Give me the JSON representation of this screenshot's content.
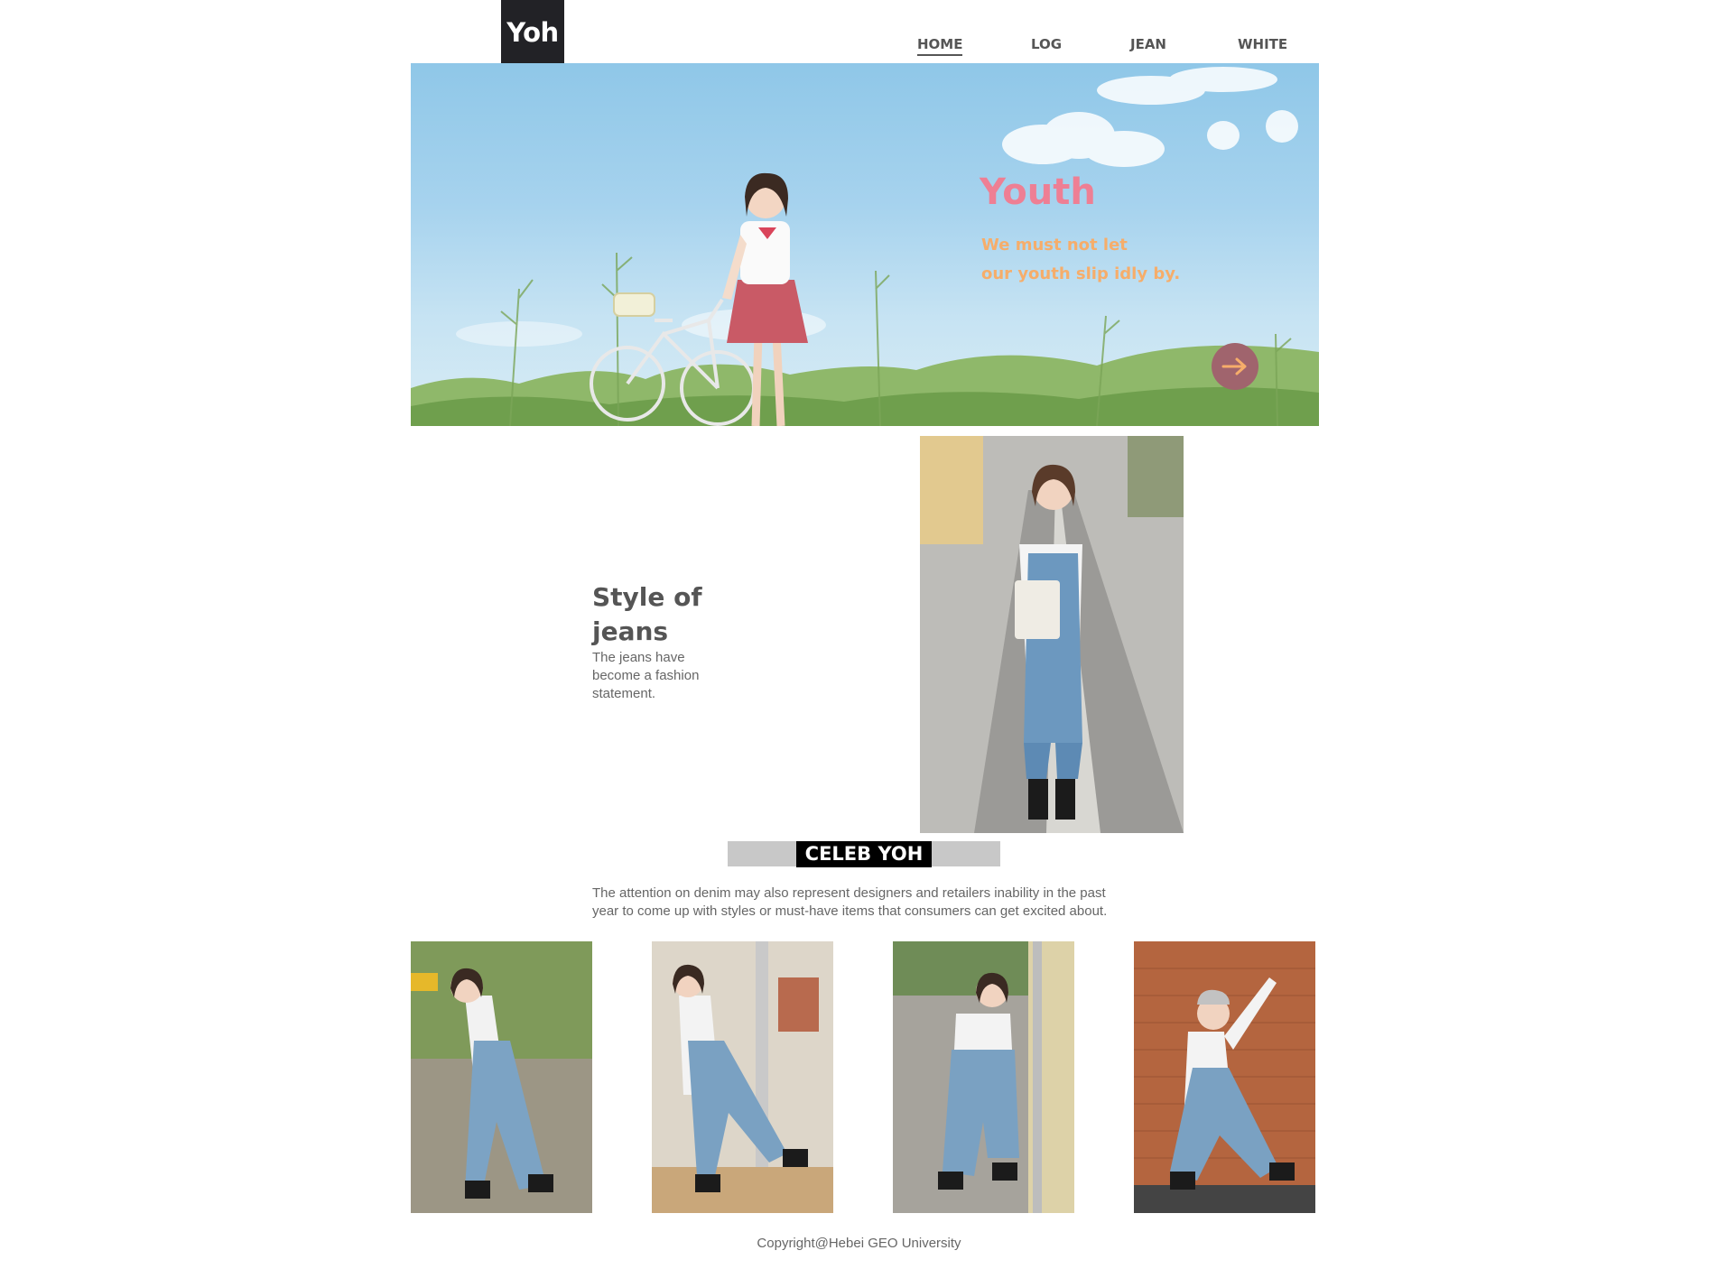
{
  "header": {
    "logo_text": "Yoh",
    "nav": [
      {
        "label": "HOME",
        "active": true
      },
      {
        "label": "LOG",
        "active": false
      },
      {
        "label": "JEAN",
        "active": false
      },
      {
        "label": "WHITE",
        "active": false
      }
    ]
  },
  "hero": {
    "title": "Youth",
    "subtitle_line1": "We must not let",
    "subtitle_line2": "our youth slip idly by.",
    "arrow_icon": "arrow-right-icon",
    "title_color": "#ee7f94",
    "subtitle_color": "#f6ad6a",
    "arrow_bg": "#a0646d"
  },
  "feature": {
    "title": "Style of jeans",
    "text": "The jeans have become a fashion statement."
  },
  "celeb": {
    "label": "CELEB YOH",
    "description": "The attention on denim may also represent designers and retailers inability in the past year to come up with styles or must-have items that consumers can get excited about."
  },
  "footer": {
    "copyright": "Copyright@Hebei GEO University"
  }
}
